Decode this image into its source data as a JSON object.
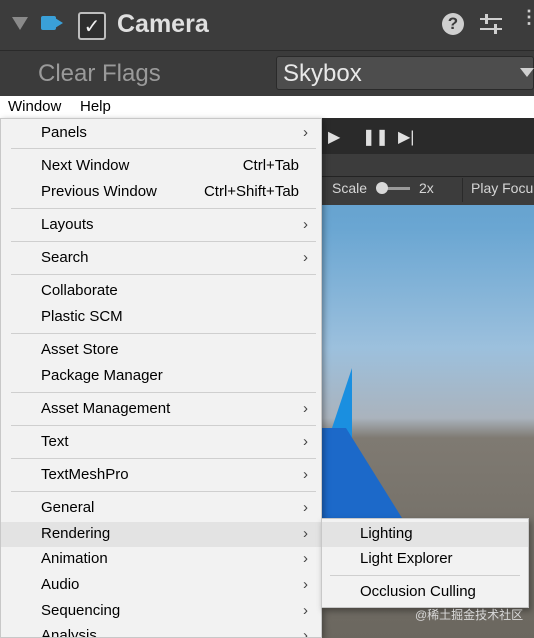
{
  "inspector": {
    "component_title": "Camera",
    "clear_flags_label": "Clear Flags",
    "clear_flags_value": "Skybox",
    "enabled_checked": true
  },
  "menubar": {
    "items": [
      "Window",
      "Help"
    ]
  },
  "scene_toolbar": {
    "scale_label": "Scale",
    "scale_value": "2x",
    "play_focus_label": "Play Focu"
  },
  "window_menu": {
    "items": [
      {
        "label": "Panels",
        "submenu": true
      },
      {
        "label": "Next Window",
        "shortcut": "Ctrl+Tab"
      },
      {
        "label": "Previous Window",
        "shortcut": "Ctrl+Shift+Tab"
      },
      {
        "label": "Layouts",
        "submenu": true
      },
      {
        "label": "Search",
        "submenu": true
      },
      {
        "label": "Collaborate"
      },
      {
        "label": "Plastic SCM"
      },
      {
        "label": "Asset Store"
      },
      {
        "label": "Package Manager"
      },
      {
        "label": "Asset Management",
        "submenu": true
      },
      {
        "label": "Text",
        "submenu": true
      },
      {
        "label": "TextMeshPro",
        "submenu": true
      },
      {
        "label": "General",
        "submenu": true
      },
      {
        "label": "Rendering",
        "submenu": true,
        "highlighted": true
      },
      {
        "label": "Animation",
        "submenu": true
      },
      {
        "label": "Audio",
        "submenu": true
      },
      {
        "label": "Sequencing",
        "submenu": true
      },
      {
        "label": "Analysis",
        "submenu": true
      }
    ]
  },
  "rendering_submenu": {
    "items": [
      {
        "label": "Lighting",
        "highlighted": true
      },
      {
        "label": "Light Explorer"
      },
      {
        "label": "Occlusion Culling"
      }
    ]
  },
  "watermark": "@稀土掘金技术社区",
  "icons": {
    "foldout": "triangle-down-icon",
    "camera": "camera-icon",
    "help": "help-icon",
    "presets": "sliders-icon",
    "more": "more-icon",
    "play": "play-icon",
    "pause": "pause-icon",
    "step": "step-icon",
    "submenu_arrow": "chevron-right-icon"
  },
  "colors": {
    "camera_icon": "#3aa0d8",
    "menu_bg": "#f2f2f2",
    "menu_highlight": "#e3e3e3",
    "inspector_bg": "#3b3b3b"
  }
}
